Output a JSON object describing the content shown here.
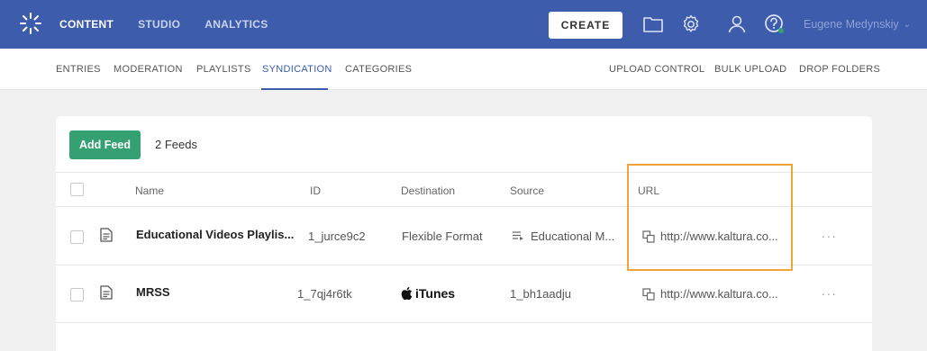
{
  "topbar": {
    "nav": [
      "CONTENT",
      "STUDIO",
      "ANALYTICS"
    ],
    "active_nav": "CONTENT",
    "create_label": "CREATE",
    "user_name": "Eugene Medynskiy",
    "icons": [
      "kaltura-logo-icon",
      "folder-icon",
      "gear-icon",
      "user-icon",
      "help-icon"
    ],
    "colors": {
      "bar": "#3d5cab",
      "accent_green": "#35a072",
      "highlight": "#f2a33a"
    }
  },
  "subnav": {
    "left": [
      "ENTRIES",
      "MODERATION",
      "PLAYLISTS",
      "SYNDICATION",
      "CATEGORIES"
    ],
    "active": "SYNDICATION",
    "right": [
      "UPLOAD CONTROL",
      "BULK UPLOAD",
      "DROP FOLDERS"
    ]
  },
  "toolbar": {
    "add_feed_label": "Add Feed",
    "count_label": "2 Feeds"
  },
  "table": {
    "headers": [
      "Name",
      "ID",
      "Destination",
      "Source",
      "URL"
    ],
    "rows": [
      {
        "name": "Educational Videos Playlis...",
        "id": "1_jurce9c2",
        "destination": "Flexible Format",
        "source": "Educational M...",
        "url": "http://www.kaltura.co...",
        "more": "..."
      },
      {
        "name": "MRSS",
        "id": "1_7qj4r6tk",
        "destination": "iTunes",
        "source": "1_bh1aadju",
        "url": "http://www.kaltura.co...",
        "more": "..."
      }
    ]
  }
}
